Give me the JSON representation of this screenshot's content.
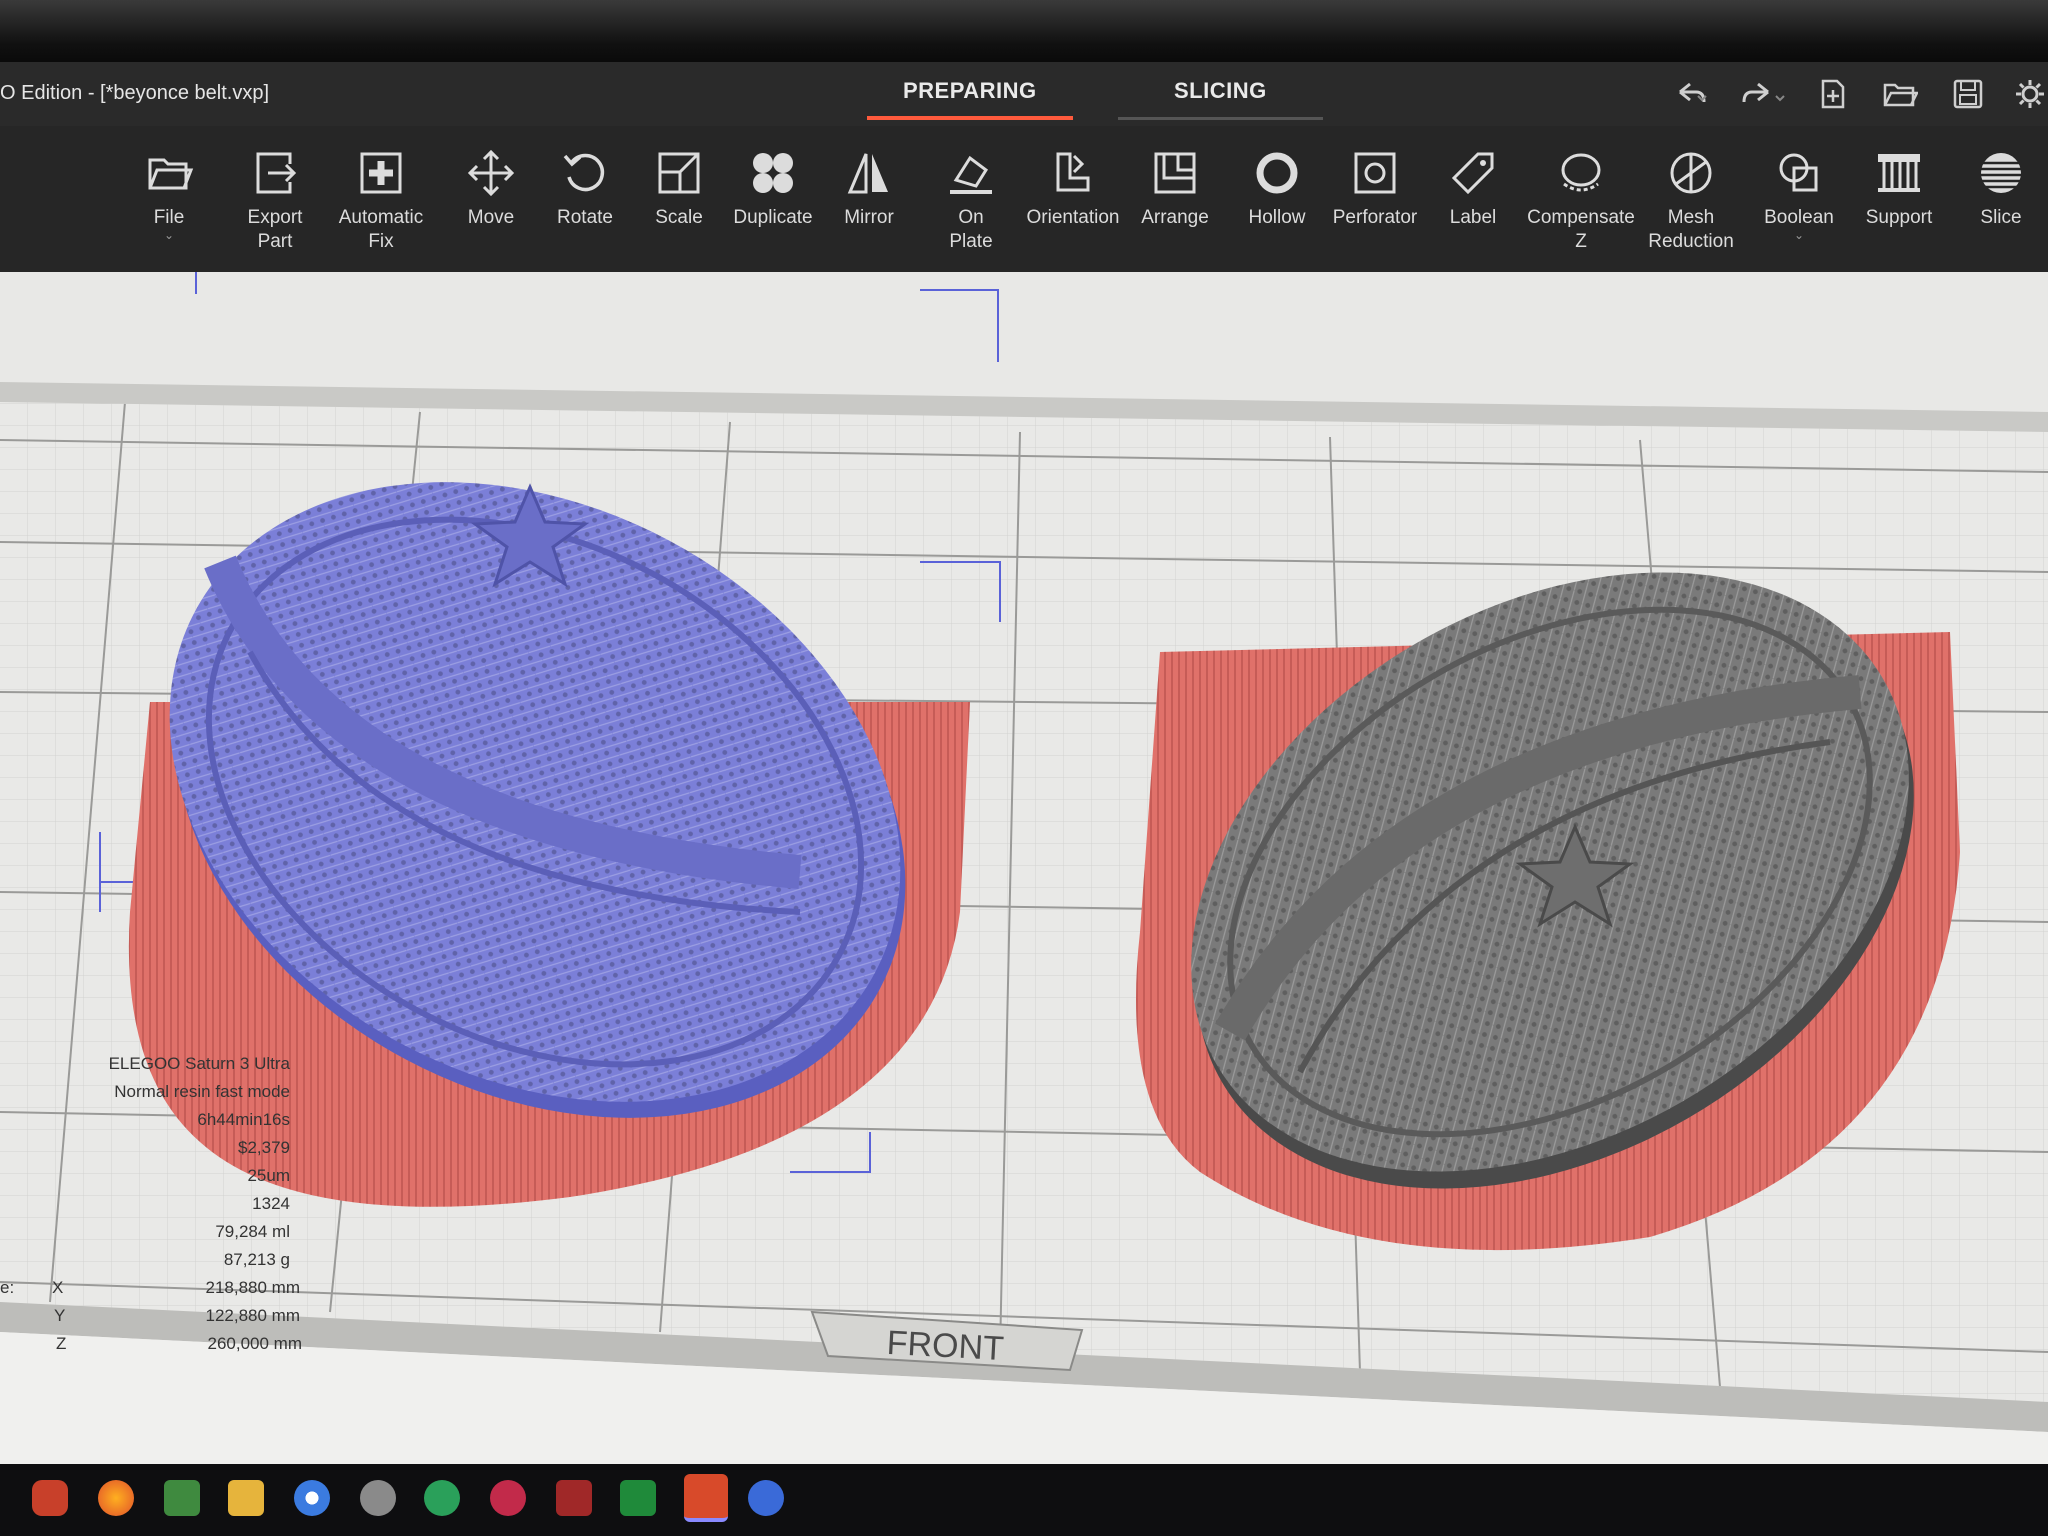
{
  "window": {
    "title": "O Edition - [*beyonce belt.vxp]"
  },
  "modes": {
    "preparing": "PREPARING",
    "slicing": "SLICING"
  },
  "toolbar": {
    "file": "File",
    "export_part": "Export\nPart",
    "automatic_fix": "Automatic\nFix",
    "move": "Move",
    "rotate": "Rotate",
    "scale": "Scale",
    "duplicate": "Duplicate",
    "mirror": "Mirror",
    "on_plate": "On\nPlate",
    "orientation": "Orientation",
    "arrange": "Arrange",
    "hollow": "Hollow",
    "perforator": "Perforator",
    "label": "Label",
    "compensate_z": "Compensate\nZ",
    "mesh_reduction": "Mesh\nReduction",
    "boolean": "Boolean",
    "support": "Support",
    "slice": "Slice"
  },
  "viewport": {
    "front_label": "FRONT"
  },
  "info": {
    "printer": "ELEGOO Saturn 3 Ultra",
    "profile": "Normal resin fast mode",
    "time": "6h44min16s",
    "cost": "$2,379",
    "layer_height": "25um",
    "layers": "1324",
    "volume": "79,284 ml",
    "weight": "87,213 g",
    "size_prefix": "e:",
    "x_label": "X",
    "x_value": "218,880 mm",
    "y_label": "Y",
    "y_value": "122,880 mm",
    "z_label": "Z",
    "z_value": "260,000 mm"
  },
  "colors": {
    "selected_part": "#7b7fd8",
    "unselected_part": "#7a7a7a",
    "supports": "#e0716a",
    "accent": "#ff5a3c"
  },
  "icons": [
    "undo-icon",
    "redo-icon",
    "new-project-icon",
    "open-folder-icon",
    "save-icon",
    "settings-gear-icon"
  ]
}
